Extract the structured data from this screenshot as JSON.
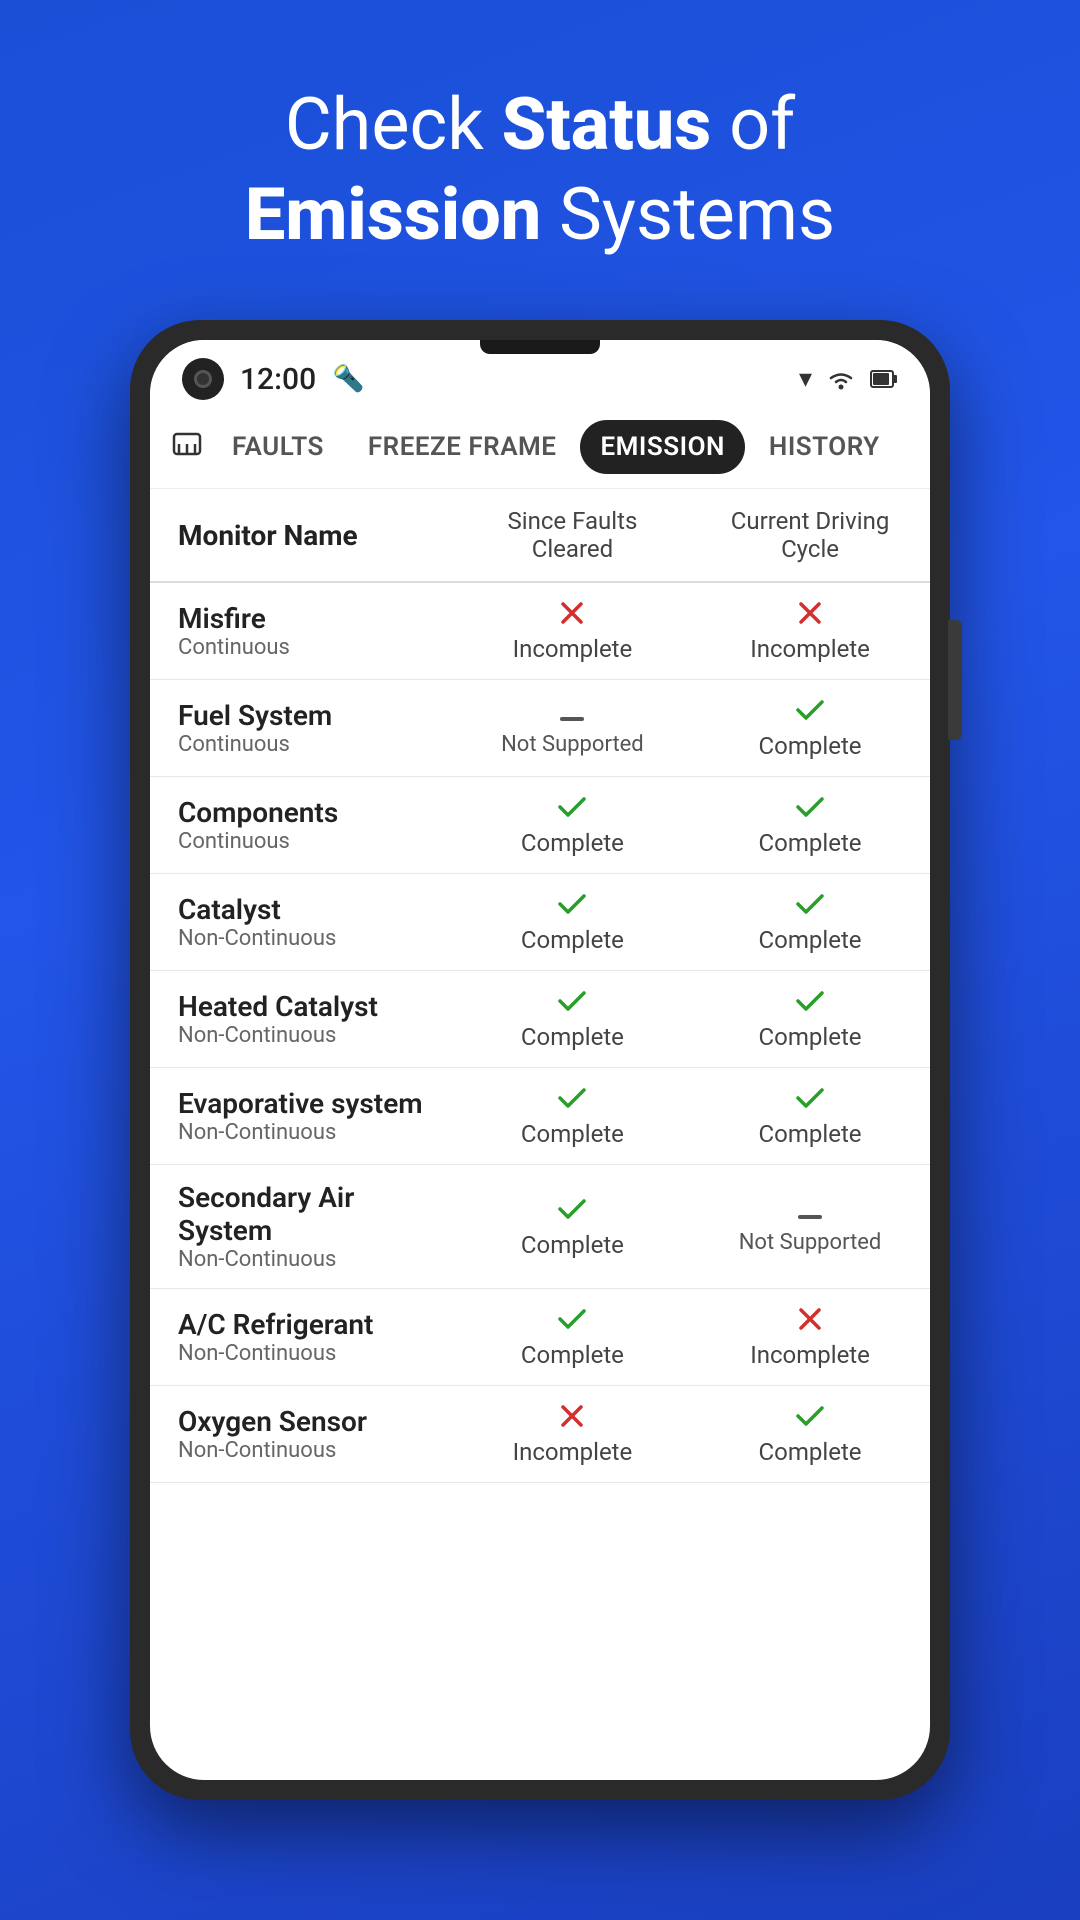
{
  "hero": {
    "line1": "Check ",
    "line1_bold": "Status",
    "line1_end": " of",
    "line2_bold": "Emission",
    "line2_end": " Systems"
  },
  "status_bar": {
    "time": "12:00",
    "flash_symbol": "⚡"
  },
  "tabs": [
    {
      "id": "faults",
      "label": "Faults",
      "active": false
    },
    {
      "id": "freeze-frame",
      "label": "Freeze Frame",
      "active": false
    },
    {
      "id": "emission",
      "label": "Emission",
      "active": true
    },
    {
      "id": "history",
      "label": "History",
      "active": false
    }
  ],
  "table": {
    "headers": {
      "col1": "Monitor Name",
      "col2": "Since Faults Cleared",
      "col3": "Current Driving Cycle"
    },
    "rows": [
      {
        "name": "Misfire",
        "type": "Continuous",
        "col2_icon": "✗",
        "col2_status": "incomplete",
        "col2_text": "Incomplete",
        "col3_icon": "✗",
        "col3_status": "incomplete",
        "col3_text": "Incomplete"
      },
      {
        "name": "Fuel System",
        "type": "Continuous",
        "col2_icon": "—",
        "col2_status": "not-supported",
        "col2_text": "Not Supported",
        "col3_icon": "✓",
        "col3_status": "complete",
        "col3_text": "Complete"
      },
      {
        "name": "Components",
        "type": "Continuous",
        "col2_icon": "✓",
        "col2_status": "complete",
        "col2_text": "Complete",
        "col3_icon": "✓",
        "col3_status": "complete",
        "col3_text": "Complete"
      },
      {
        "name": "Catalyst",
        "type": "Non-Continuous",
        "col2_icon": "✓",
        "col2_status": "complete",
        "col2_text": "Complete",
        "col3_icon": "✓",
        "col3_status": "complete",
        "col3_text": "Complete"
      },
      {
        "name": "Heated Catalyst",
        "type": "Non-Continuous",
        "col2_icon": "✓",
        "col2_status": "complete",
        "col2_text": "Complete",
        "col3_icon": "✓",
        "col3_status": "complete",
        "col3_text": "Complete"
      },
      {
        "name": "Evaporative system",
        "type": "Non-Continuous",
        "col2_icon": "✓",
        "col2_status": "complete",
        "col2_text": "Complete",
        "col3_icon": "✓",
        "col3_status": "complete",
        "col3_text": "Complete"
      },
      {
        "name": "Secondary Air System",
        "type": "Non-Continuous",
        "col2_icon": "✓",
        "col2_status": "complete",
        "col2_text": "Complete",
        "col3_icon": "—",
        "col3_status": "not-supported",
        "col3_text": "Not Supported"
      },
      {
        "name": "A/C Refrigerant",
        "type": "Non-Continuous",
        "col2_icon": "✓",
        "col2_status": "complete",
        "col2_text": "Complete",
        "col3_icon": "✗",
        "col3_status": "incomplete",
        "col3_text": "Incomplete"
      },
      {
        "name": "Oxygen Sensor",
        "type": "Non-Continuous",
        "col2_icon": "✗",
        "col2_status": "incomplete",
        "col2_text": "Incomplete",
        "col3_icon": "✓",
        "col3_status": "complete",
        "col3_text": "Complete"
      }
    ]
  }
}
